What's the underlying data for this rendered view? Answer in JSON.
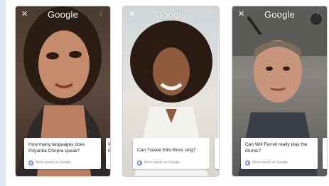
{
  "cards": [
    {
      "logo": "Google",
      "question": "How many languages does Priyanka Chopra speak?",
      "footer": "Most asked on Google",
      "next_peek": "W\nM"
    },
    {
      "logo": "Google",
      "question": "Can Tracee Ellis Ross sing?",
      "footer": "Most asked on Google",
      "next_peek": ""
    },
    {
      "logo": "Google",
      "question": "Can Will Ferrell really play the drums?",
      "footer": "Most asked on Google",
      "next_peek": ""
    }
  ],
  "icons": {
    "close": "close-icon",
    "menu": "more-vert-icon",
    "google": "google-g-icon"
  }
}
